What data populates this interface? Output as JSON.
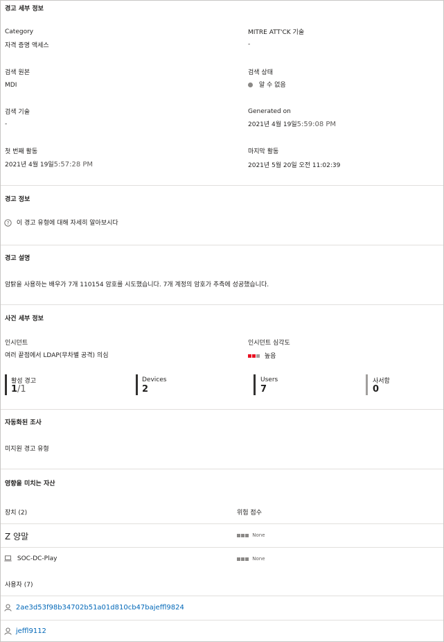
{
  "alert_details": {
    "heading": "경고 세부 정보",
    "category_label": "Category",
    "category_value": "자격 증명 액세스",
    "mitre_label": "MITRE ATT'CK 기술",
    "mitre_value": "-",
    "detection_source_label": "검색 원본",
    "detection_source_value": "MDI",
    "detection_status_label": "검색 상태",
    "detection_status_value": "알 수 없음",
    "detection_tech_label": "검색 기술",
    "detection_tech_value": "-",
    "generated_on_label": "Generated on",
    "generated_on_date": "2021년 4월 19일",
    "generated_on_time": "5:59:08 PM",
    "first_activity_label": "첫 번째 활동",
    "first_activity_date": "2021년 4월 19일",
    "first_activity_time": "5:57:28 PM",
    "last_activity_label": "마지막 활동",
    "last_activity_value": "2021년 5월 20일 오전 11:02:39"
  },
  "alert_info": {
    "heading": "경고 정보",
    "learn_more": "이 경고 유형에 대해 자세히 알아보시다"
  },
  "alert_description": {
    "heading": "경고 설명",
    "text": "암탉을 사용하는 배우가 7개 110154 암호를 시도했습니다. 7개 계정의 암호가 추측에 성공했습니다."
  },
  "incident_details": {
    "heading": "사건 세부 정보",
    "incident_label": "인시던트",
    "incident_value": "여러 끝점에서 LDAP(무차별 공격) 의심",
    "severity_label": "인시던트 심각도",
    "severity_value": "높음",
    "colors": {
      "severity_high": "#e81123",
      "severity_off": "#a19f9d"
    },
    "stats": {
      "active_alerts_label": "활성 경고",
      "active_alerts_num": "1",
      "active_alerts_den": "/1",
      "devices_label": "Devices",
      "devices_value": "2",
      "users_label": "Users",
      "users_value": "7",
      "mailbox_label": "사서함",
      "mailbox_value": "0"
    }
  },
  "automated_investigation": {
    "heading": "자동화된 조사",
    "value": "미지원 경고 유형"
  },
  "impacted_assets": {
    "heading": "영향을 미치는 자산",
    "devices_header": "장치 (2)",
    "risk_header": "위험 점수",
    "devices": [
      {
        "name": "Z 양말",
        "risk": "None"
      },
      {
        "name": "SOC-DC-Play",
        "risk": "None"
      }
    ],
    "users_header": "사용자 (7)",
    "users": [
      {
        "name": "2ae3d53f98b34702b51a01d810cb47bajeffl9824"
      },
      {
        "name": "jeffl9112"
      }
    ]
  }
}
